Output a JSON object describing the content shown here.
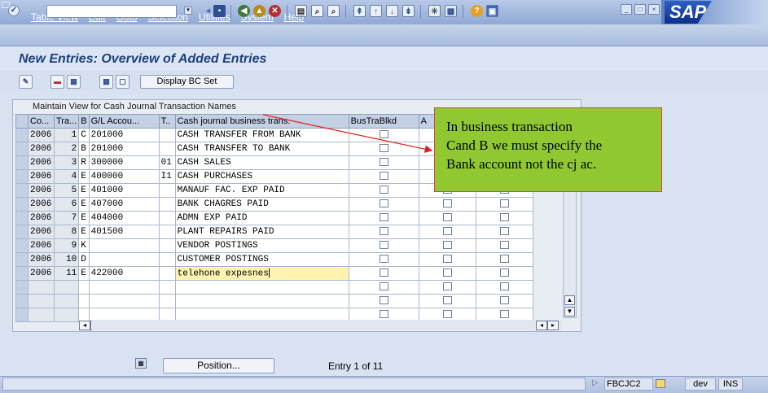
{
  "menu": [
    "Table View",
    "Edit",
    "Goto",
    "Selection",
    "Utilities",
    "System",
    "Help"
  ],
  "logo": "SAP",
  "title": "New Entries: Overview of Added Entries",
  "app_toolbar": {
    "display_bc_set": "Display BC Set"
  },
  "table": {
    "title": "Maintain View for Cash Journal Transaction Names",
    "columns": [
      "Co...",
      "Tra...",
      "B",
      "G/L Accou...",
      "T..",
      "Cash journal business trans.",
      "BusTraBlkd",
      "A",
      "",
      ""
    ],
    "rows": [
      {
        "co": "2006",
        "tra": "1",
        "b": "C",
        "gl": "201000",
        "t": "",
        "name": "CASH TRANSFER FROM BANK"
      },
      {
        "co": "2006",
        "tra": "2",
        "b": "B",
        "gl": "201000",
        "t": "",
        "name": "CASH TRANSFER TO BANK"
      },
      {
        "co": "2006",
        "tra": "3",
        "b": "R",
        "gl": "300000",
        "t": "01",
        "name": "CASH SALES"
      },
      {
        "co": "2006",
        "tra": "4",
        "b": "E",
        "gl": "400000",
        "t": "I1",
        "name": "CASH PURCHASES"
      },
      {
        "co": "2006",
        "tra": "5",
        "b": "E",
        "gl": "401000",
        "t": "",
        "name": "MANAUF FAC. EXP PAID"
      },
      {
        "co": "2006",
        "tra": "6",
        "b": "E",
        "gl": "407000",
        "t": "",
        "name": "BANK CHAGRES PAID"
      },
      {
        "co": "2006",
        "tra": "7",
        "b": "E",
        "gl": "404000",
        "t": "",
        "name": "ADMN EXP PAID"
      },
      {
        "co": "2006",
        "tra": "8",
        "b": "E",
        "gl": "401500",
        "t": "",
        "name": "PLANT REPAIRS PAID"
      },
      {
        "co": "2006",
        "tra": "9",
        "b": "K",
        "gl": "",
        "t": "",
        "name": "VENDOR POSTINGS"
      },
      {
        "co": "2006",
        "tra": "10",
        "b": "D",
        "gl": "",
        "t": "",
        "name": "CUSTOMER POSTINGS"
      },
      {
        "co": "2006",
        "tra": "11",
        "b": "E",
        "gl": "422000",
        "t": "",
        "name": "telehone expesnes"
      }
    ]
  },
  "bottom": {
    "position_label": "Position...",
    "entry_info": "Entry 1 of 11"
  },
  "status": {
    "system": "FBCJC2",
    "client": "dev",
    "mode": "INS"
  },
  "callout": {
    "lines": [
      "In business transaction",
      "Cand B we must specify the",
      "Bank account not the cj ac."
    ]
  },
  "colors": {
    "callout_bg": "#8fc830",
    "title_color": "#1e3f7e",
    "arrow": "#e02020"
  }
}
